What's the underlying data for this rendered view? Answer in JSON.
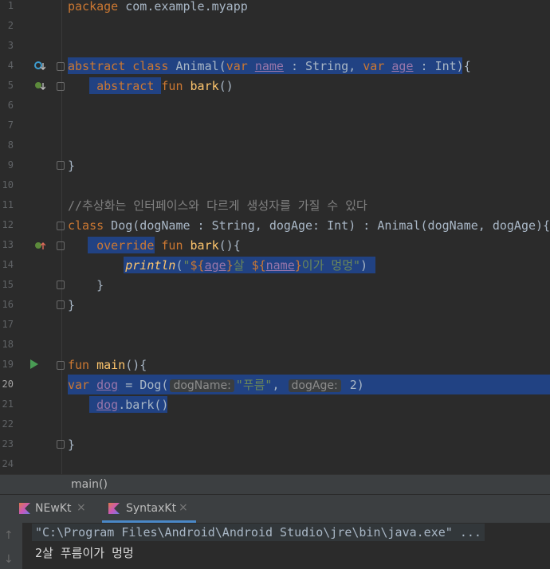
{
  "editor": {
    "lines": [
      {
        "n": "1"
      },
      {
        "n": "2"
      },
      {
        "n": "3"
      },
      {
        "n": "4"
      },
      {
        "n": "5"
      },
      {
        "n": "6"
      },
      {
        "n": "7"
      },
      {
        "n": "8"
      },
      {
        "n": "9"
      },
      {
        "n": "10"
      },
      {
        "n": "11"
      },
      {
        "n": "12"
      },
      {
        "n": "13"
      },
      {
        "n": "14"
      },
      {
        "n": "15"
      },
      {
        "n": "16"
      },
      {
        "n": "17"
      },
      {
        "n": "18"
      },
      {
        "n": "19"
      },
      {
        "n": "20"
      },
      {
        "n": "21"
      },
      {
        "n": "22"
      },
      {
        "n": "23"
      },
      {
        "n": "24"
      }
    ],
    "code": {
      "l0_kw": "package",
      "l0_text": " com.example.myapp",
      "l3_kw1": "abstract",
      "l3_sp1": " ",
      "l3_kw2": "class",
      "l3_t1": " Animal(",
      "l3_kw3": "var",
      "l3_sp2": " ",
      "l3_p1": "name",
      "l3_t2": " : String,",
      "l3_sp3": " ",
      "l3_kw4": "var",
      "l3_sp4": " ",
      "l3_p2": "age",
      "l3_t3": " : Int){",
      "l4_indent": "    ",
      "l4_kw1": "abstract",
      "l4_sp1": " ",
      "l4_kw2": "fun",
      "l4_sp2": " ",
      "l4_fn": "bark",
      "l4_t": "()",
      "l8_t": "}",
      "l10_cmt": "//추상화는 인터페이스와 다르게 생성자를 가질 수 있다",
      "l11_kw": "class",
      "l11_t1": " Dog(dogName : String, dogAge: Int) : Animal(dogName, dogAge){",
      "l12_indent": "    ",
      "l12_kw1": "override",
      "l12_sp1": " ",
      "l12_kw2": "fun",
      "l12_sp2": " ",
      "l12_fn": "bark",
      "l12_t": "(){",
      "l13_indent": "        ",
      "l13_fn": "println",
      "l13_t1": "(",
      "l13_s1": "\"",
      "l13_tp1": "${",
      "l13_p1": "age",
      "l13_tp2": "}",
      "l13_s2": "살 ",
      "l13_tp3": "${",
      "l13_p2": "name",
      "l13_tp4": "}",
      "l13_s3": "이가 멍멍\"",
      "l13_t2": ")",
      "l14_t": "    }",
      "l15_t": "}",
      "l18_kw": "fun",
      "l18_sp": " ",
      "l18_fn": "main",
      "l18_t": "(){",
      "l19_kw": "var",
      "l19_sp1": " ",
      "l19_p": "dog",
      "l19_t1": " = Dog(",
      "l19_h1": "dogName:",
      "l19_s1": "\"푸름\"",
      "l19_t2": ", ",
      "l19_h2": "dogAge:",
      "l19_t3": " 2)",
      "l20_indent": "    ",
      "l20_p": "dog",
      "l20_t": ".bark()",
      "l22_t": "}"
    }
  },
  "breadcrumb": {
    "item": "main()"
  },
  "run_tabs": [
    {
      "label": "NEwKt",
      "close": "×"
    },
    {
      "label": "SyntaxKt",
      "close": "×"
    }
  ],
  "console": {
    "up_arrow": "↑",
    "down_arrow": "↓",
    "command": "\"C:\\Program Files\\Android\\Android Studio\\jre\\bin\\java.exe\" ...",
    "output": "2살 푸름이가 멍멍"
  },
  "colors": {
    "background": "#2b2b2b",
    "selection": "#214283",
    "keyword": "#cc7832",
    "string": "#6a8759",
    "property": "#9876aa",
    "function": "#ffc66d",
    "comment": "#808080"
  }
}
